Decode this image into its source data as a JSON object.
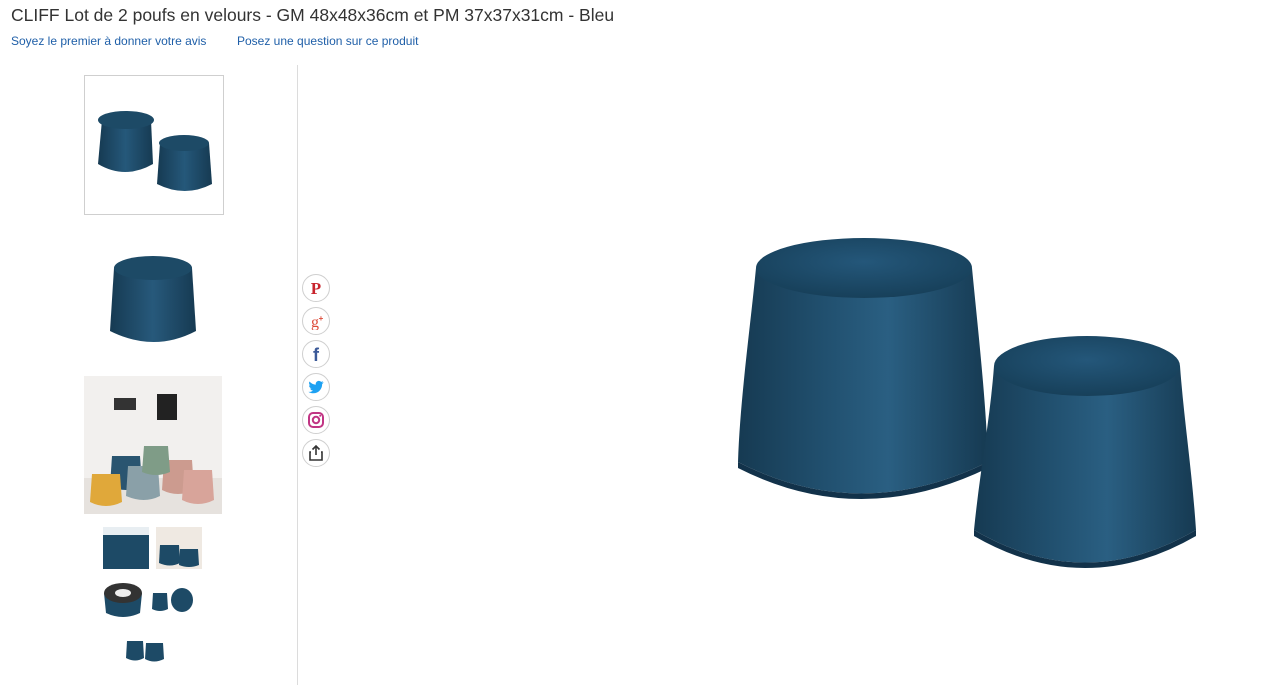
{
  "product": {
    "title": "CLIFF Lot de 2 poufs en velours - GM 48x48x36cm et PM 37x37x31cm - Bleu",
    "review_link": "Soyez le premier à donner votre avis",
    "question_link": "Posez une question sur ce produit"
  },
  "gallery": {
    "thumbnails": [
      {
        "icon": "pouf-pair-thumb",
        "active": true
      },
      {
        "icon": "pouf-single-thumb",
        "active": false
      },
      {
        "icon": "pouf-lifestyle-thumb",
        "active": false
      },
      {
        "icon": "pouf-closeup-thumb",
        "active": false
      },
      {
        "icon": "pouf-room-thumb",
        "active": false
      },
      {
        "icon": "pouf-top-open-thumb",
        "active": false
      },
      {
        "icon": "pouf-pair-small-thumb",
        "active": false
      },
      {
        "icon": "pouf-pair-tiny-thumb",
        "active": false
      }
    ]
  },
  "share": [
    {
      "icon": "pinterest-icon",
      "color": "#c8232c"
    },
    {
      "icon": "google-plus-icon",
      "color": "#dd4b39"
    },
    {
      "icon": "facebook-icon",
      "color": "#3b5998"
    },
    {
      "icon": "twitter-icon",
      "color": "#1da1f2"
    },
    {
      "icon": "instagram-icon",
      "color": "#c13584"
    },
    {
      "icon": "share-icon",
      "color": "#333333"
    }
  ],
  "colors": {
    "velvet": "#1f4a66",
    "velvet_dark": "#163a52",
    "link": "#1f5fa8"
  }
}
